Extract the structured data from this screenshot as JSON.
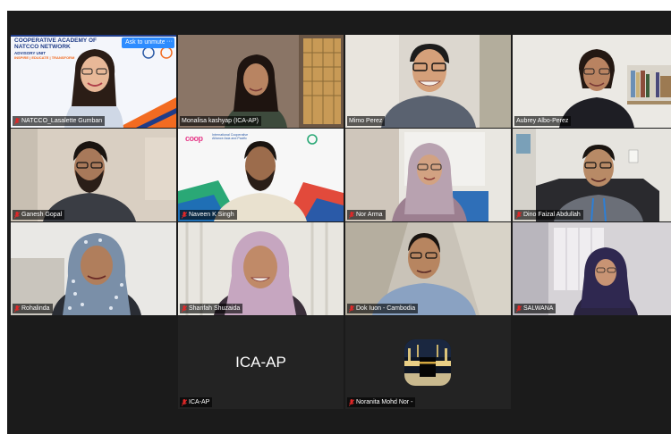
{
  "meeting": {
    "unmute_label": "Ask to unmute",
    "more_label": "···",
    "participants": [
      {
        "name": "NATCCO_Lasalette Gumban",
        "muted": true
      },
      {
        "name": "Monalisa kashyap (ICA-AP)",
        "muted": false
      },
      {
        "name": "Mimo Perez",
        "muted": false
      },
      {
        "name": "Aubrey Albo-Perez",
        "muted": false,
        "active_speaker": true
      },
      {
        "name": "Ganesh Gopal",
        "muted": true
      },
      {
        "name": "Naveen K Singh",
        "muted": true
      },
      {
        "name": "Nor Arma",
        "muted": true
      },
      {
        "name": "Dino Faizal Abdullah",
        "muted": true
      },
      {
        "name": "Rohalinda",
        "muted": true
      },
      {
        "name": "Sharifah Shuzaida",
        "muted": true
      },
      {
        "name": "Dok Iuon - Cambodia",
        "muted": true
      },
      {
        "name": "SALWANA",
        "muted": true
      },
      {
        "name": "ICA-AP",
        "muted": true,
        "display_text": "ICA-AP"
      },
      {
        "name": "Noranita Mohd Nor -",
        "muted": true
      }
    ]
  },
  "virtual_backgrounds": {
    "natcco": {
      "title": "COOPERATIVE ACADEMY OF NATCCO NETWORK",
      "subtitle": "ADVISORY UNIT",
      "tagline": "INSPIRE | EDUCATE | TRANSFORM"
    },
    "ica": {
      "logo": "coop",
      "org": "International Cooperative Alliance Asia and Pacific"
    }
  },
  "colors": {
    "stage": "#1b1b1b",
    "active_border": "#2ecc40",
    "unmute_button": "#2d8cff",
    "mic_muted": "#e02828"
  }
}
